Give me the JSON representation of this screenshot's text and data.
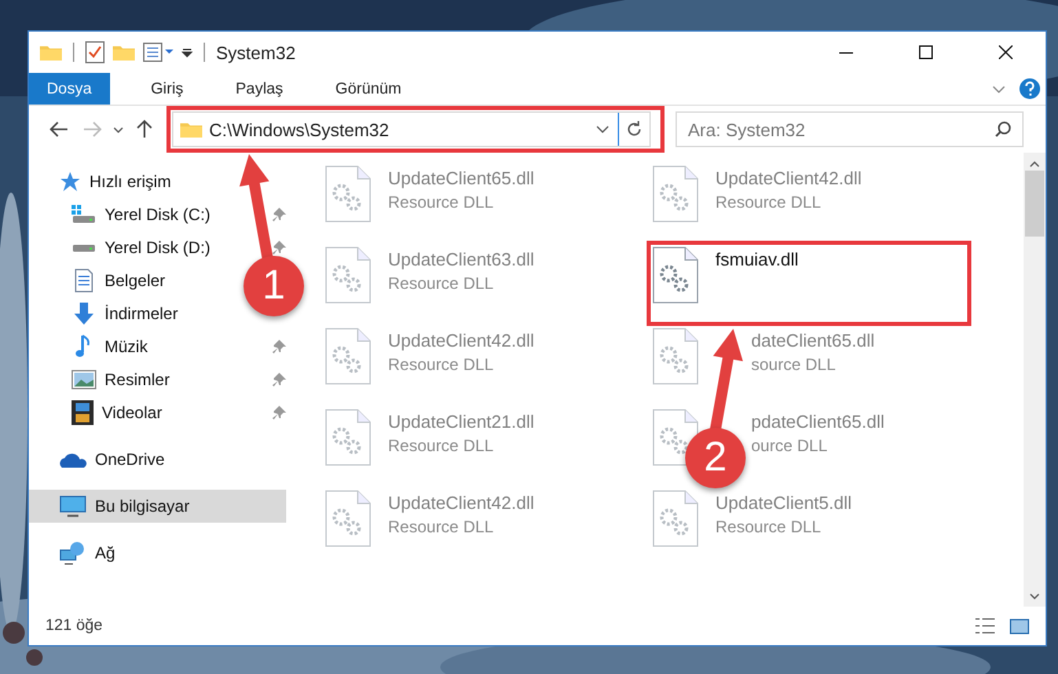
{
  "window": {
    "title": "System32"
  },
  "ribbon_tabs": [
    {
      "label": "Dosya",
      "selected": true
    },
    {
      "label": "Giriş",
      "selected": false
    },
    {
      "label": "Paylaş",
      "selected": false
    },
    {
      "label": "Görünüm",
      "selected": false
    }
  ],
  "address": {
    "path": "C:\\Windows\\System32"
  },
  "search": {
    "placeholder": "Ara: System32"
  },
  "sidebar": {
    "items": [
      {
        "label": "Hızlı erişim",
        "selected": false,
        "children": [
          {
            "label": "Yerel Disk (C:)",
            "pinned": true,
            "selected": false
          },
          {
            "label": "Yerel Disk (D:)",
            "pinned": true,
            "selected": false
          },
          {
            "label": "Belgeler",
            "pinned": false,
            "selected": false
          },
          {
            "label": "İndirmeler",
            "pinned": false,
            "selected": false
          },
          {
            "label": "Müzik",
            "pinned": true,
            "selected": false
          },
          {
            "label": "Resimler",
            "pinned": true,
            "selected": false
          },
          {
            "label": "Videolar",
            "pinned": true,
            "selected": false
          }
        ]
      },
      {
        "label": "OneDrive",
        "selected": false
      },
      {
        "label": "Bu bilgisayar",
        "selected": true
      },
      {
        "label": "Ağ",
        "selected": false
      }
    ]
  },
  "files": [
    {
      "name": "UpdateClient65.dll",
      "type": "Resource DLL",
      "faded": true,
      "covered": false
    },
    {
      "name": "UpdateClient42.dll",
      "type": "Resource DLL",
      "faded": true,
      "covered": false
    },
    {
      "name": "UpdateClient63.dll",
      "type": "Resource DLL",
      "faded": true,
      "covered": false
    },
    {
      "name": "fsmuiav.dll",
      "faded": false,
      "covered": false
    },
    {
      "name": "UpdateClient42.dll",
      "type": "Resource DLL",
      "faded": true,
      "covered": false
    },
    {
      "name": "dateClient65.dll",
      "type": "source DLL",
      "faded": true,
      "covered": true
    },
    {
      "name": "UpdateClient21.dll",
      "type": "Resource DLL",
      "faded": true,
      "covered": false
    },
    {
      "name": "pdateClient65.dll",
      "type": "ource DLL",
      "faded": true,
      "covered": true
    },
    {
      "name": "UpdateClient42.dll",
      "type": "Resource DLL",
      "faded": true,
      "covered": false
    },
    {
      "name": "UpdateClient5.dll",
      "type": "Resource DLL",
      "faded": true,
      "covered": false
    }
  ],
  "status_bar": {
    "count": "121 öğe"
  },
  "annotations": [
    {
      "label": "1"
    },
    {
      "label": "2"
    }
  ]
}
